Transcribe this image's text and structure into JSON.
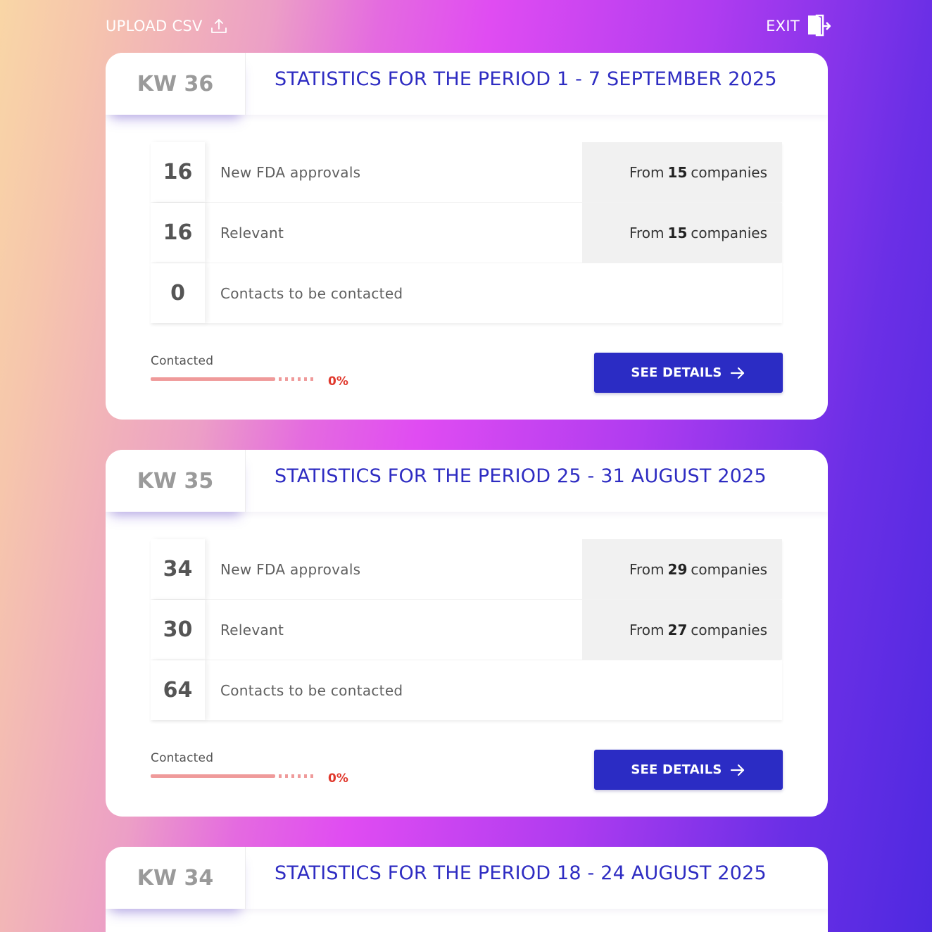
{
  "topbar": {
    "upload_label": "UPLOAD CSV",
    "upload_icon": "upload-icon",
    "exit_label": "EXIT",
    "exit_icon": "exit-door-icon"
  },
  "cards": [
    {
      "kw": "KW 36",
      "period": "STATISTICS FOR THE PERIOD 1 - 7 SEPTEMBER 2025",
      "rows": [
        {
          "count": "16",
          "label": "New FDA approvals",
          "from_prefix": "From",
          "from_count": "15",
          "from_suffix": "companies"
        },
        {
          "count": "16",
          "label": "Relevant",
          "from_prefix": "From",
          "from_count": "15",
          "from_suffix": "companies"
        },
        {
          "count": "0",
          "label": "Contacts to be contacted"
        }
      ],
      "progress": {
        "label": "Contacted",
        "percent_text": "0%",
        "value": 0
      },
      "button": {
        "label": "SEE DETAILS",
        "icon": "arrow-right-icon"
      }
    },
    {
      "kw": "KW 35",
      "period": "STATISTICS FOR THE PERIOD 25 - 31 AUGUST 2025",
      "rows": [
        {
          "count": "34",
          "label": "New FDA approvals",
          "from_prefix": "From",
          "from_count": "29",
          "from_suffix": "companies"
        },
        {
          "count": "30",
          "label": "Relevant",
          "from_prefix": "From",
          "from_count": "27",
          "from_suffix": "companies"
        },
        {
          "count": "64",
          "label": "Contacts to be contacted"
        }
      ],
      "progress": {
        "label": "Contacted",
        "percent_text": "0%",
        "value": 0
      },
      "button": {
        "label": "SEE DETAILS",
        "icon": "arrow-right-icon"
      }
    },
    {
      "kw": "KW 34",
      "period": "STATISTICS FOR THE PERIOD 18 - 24 AUGUST 2025"
    }
  ],
  "colors": {
    "accent": "#2b2cc4",
    "period_text": "#2e2cc2",
    "progress_track": "#ef9a9a",
    "progress_percent": "#e0382c",
    "kw_text": "#9a9a9a"
  }
}
